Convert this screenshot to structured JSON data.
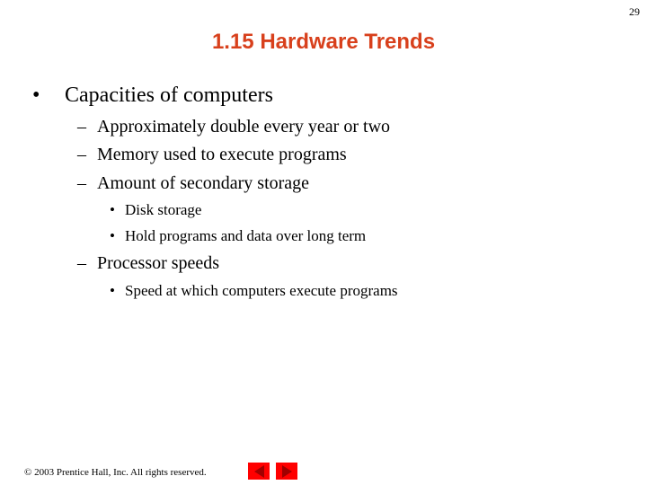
{
  "page_number": "29",
  "title": "1.15 Hardware Trends",
  "bullets": {
    "main": {
      "marker": "•",
      "text": "Capacities of computers"
    },
    "sub1": {
      "marker": "–",
      "text": "Approximately double every year or two"
    },
    "sub2": {
      "marker": "–",
      "text": "Memory used to execute programs"
    },
    "sub3": {
      "marker": "–",
      "text": "Amount of secondary storage"
    },
    "sub3a": {
      "marker": "•",
      "text": "Disk storage"
    },
    "sub3b": {
      "marker": "•",
      "text": "Hold programs and data over long term"
    },
    "sub4": {
      "marker": "–",
      "text": "Processor speeds"
    },
    "sub4a": {
      "marker": "•",
      "text": "Speed at which computers execute programs"
    }
  },
  "footer": {
    "copyright": "© 2003 Prentice Hall, Inc.  All rights reserved."
  },
  "nav": {
    "prev_icon": "triangle-left",
    "next_icon": "triangle-right",
    "color": "#ff0000"
  },
  "colors": {
    "title": "#d8401c"
  }
}
